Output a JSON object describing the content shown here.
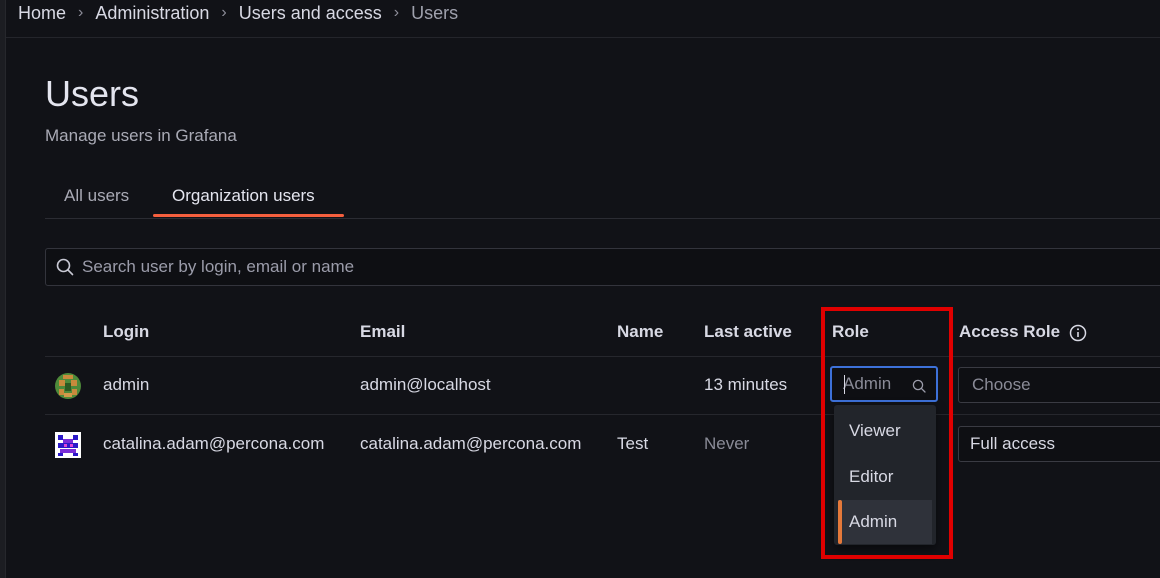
{
  "breadcrumb": {
    "items": [
      "Home",
      "Administration",
      "Users and access"
    ],
    "current": "Users",
    "separator": "›"
  },
  "page": {
    "title": "Users",
    "subtitle": "Manage users in Grafana"
  },
  "tabs": [
    {
      "label": "All users",
      "active": false
    },
    {
      "label": "Organization users",
      "active": true
    }
  ],
  "search": {
    "placeholder": "Search user by login, email or name",
    "value": ""
  },
  "table": {
    "columns": [
      "Login",
      "Email",
      "Name",
      "Last active",
      "Role",
      "Access Role"
    ],
    "rows": [
      {
        "avatar": "avatar-green-identicon",
        "login": "admin",
        "email": "admin@localhost",
        "name": "",
        "last_active": "13 minutes",
        "role": "Admin",
        "access_role": "Choose"
      },
      {
        "avatar": "avatar-blue-identicon",
        "login": "catalina.adam@percona.com",
        "email": "catalina.adam@percona.com",
        "name": "Test",
        "last_active": "Never",
        "role": "",
        "access_role": "Full access"
      }
    ]
  },
  "role_dropdown": {
    "input_placeholder": "Admin",
    "options": [
      "Viewer",
      "Editor",
      "Admin"
    ],
    "selected": "Admin"
  },
  "colors": {
    "background": "#111217",
    "tab_accent": "#f55f3e",
    "focus_border": "#3d71d9",
    "selected_bar": "#e5793a",
    "highlight_box": "#e00000"
  }
}
